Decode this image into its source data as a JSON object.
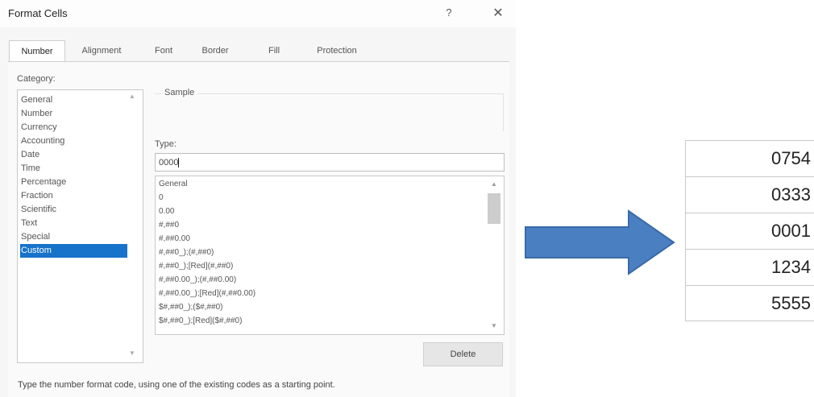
{
  "dialog": {
    "title": "Format Cells",
    "help_glyph": "?",
    "close_glyph": "✕",
    "tabs": [
      {
        "label": "Number",
        "active": true
      },
      {
        "label": "Alignment",
        "active": false
      },
      {
        "label": "Font",
        "active": false
      },
      {
        "label": "Border",
        "active": false
      },
      {
        "label": "Fill",
        "active": false
      },
      {
        "label": "Protection",
        "active": false
      }
    ],
    "category_label": "Category:",
    "categories": [
      "General",
      "Number",
      "Currency",
      "Accounting",
      "Date",
      "Time",
      "Percentage",
      "Fraction",
      "Scientific",
      "Text",
      "Special",
      "Custom"
    ],
    "selected_category": "Custom",
    "sample_label": "Sample",
    "type_label": "Type:",
    "type_value": "0000",
    "format_codes": [
      "General",
      "0",
      "0.00",
      "#,##0",
      "#,##0.00",
      "#,##0_);(#,##0)",
      "#,##0_);[Red](#,##0)",
      "#,##0.00_);(#,##0.00)",
      "#,##0.00_);[Red](#,##0.00)",
      "$#,##0_);($#,##0)",
      "$#,##0_);[Red]($#,##0)"
    ],
    "delete_label": "Delete",
    "hint": "Type the number format code, using one of the existing codes as a starting point."
  },
  "arrow": {
    "color": "#4a7fc1",
    "icon": "right-arrow-icon"
  },
  "result_cells": [
    "0754",
    "0333",
    "0001",
    "1234",
    "5555"
  ],
  "colors": {
    "selection": "#1673c9"
  }
}
